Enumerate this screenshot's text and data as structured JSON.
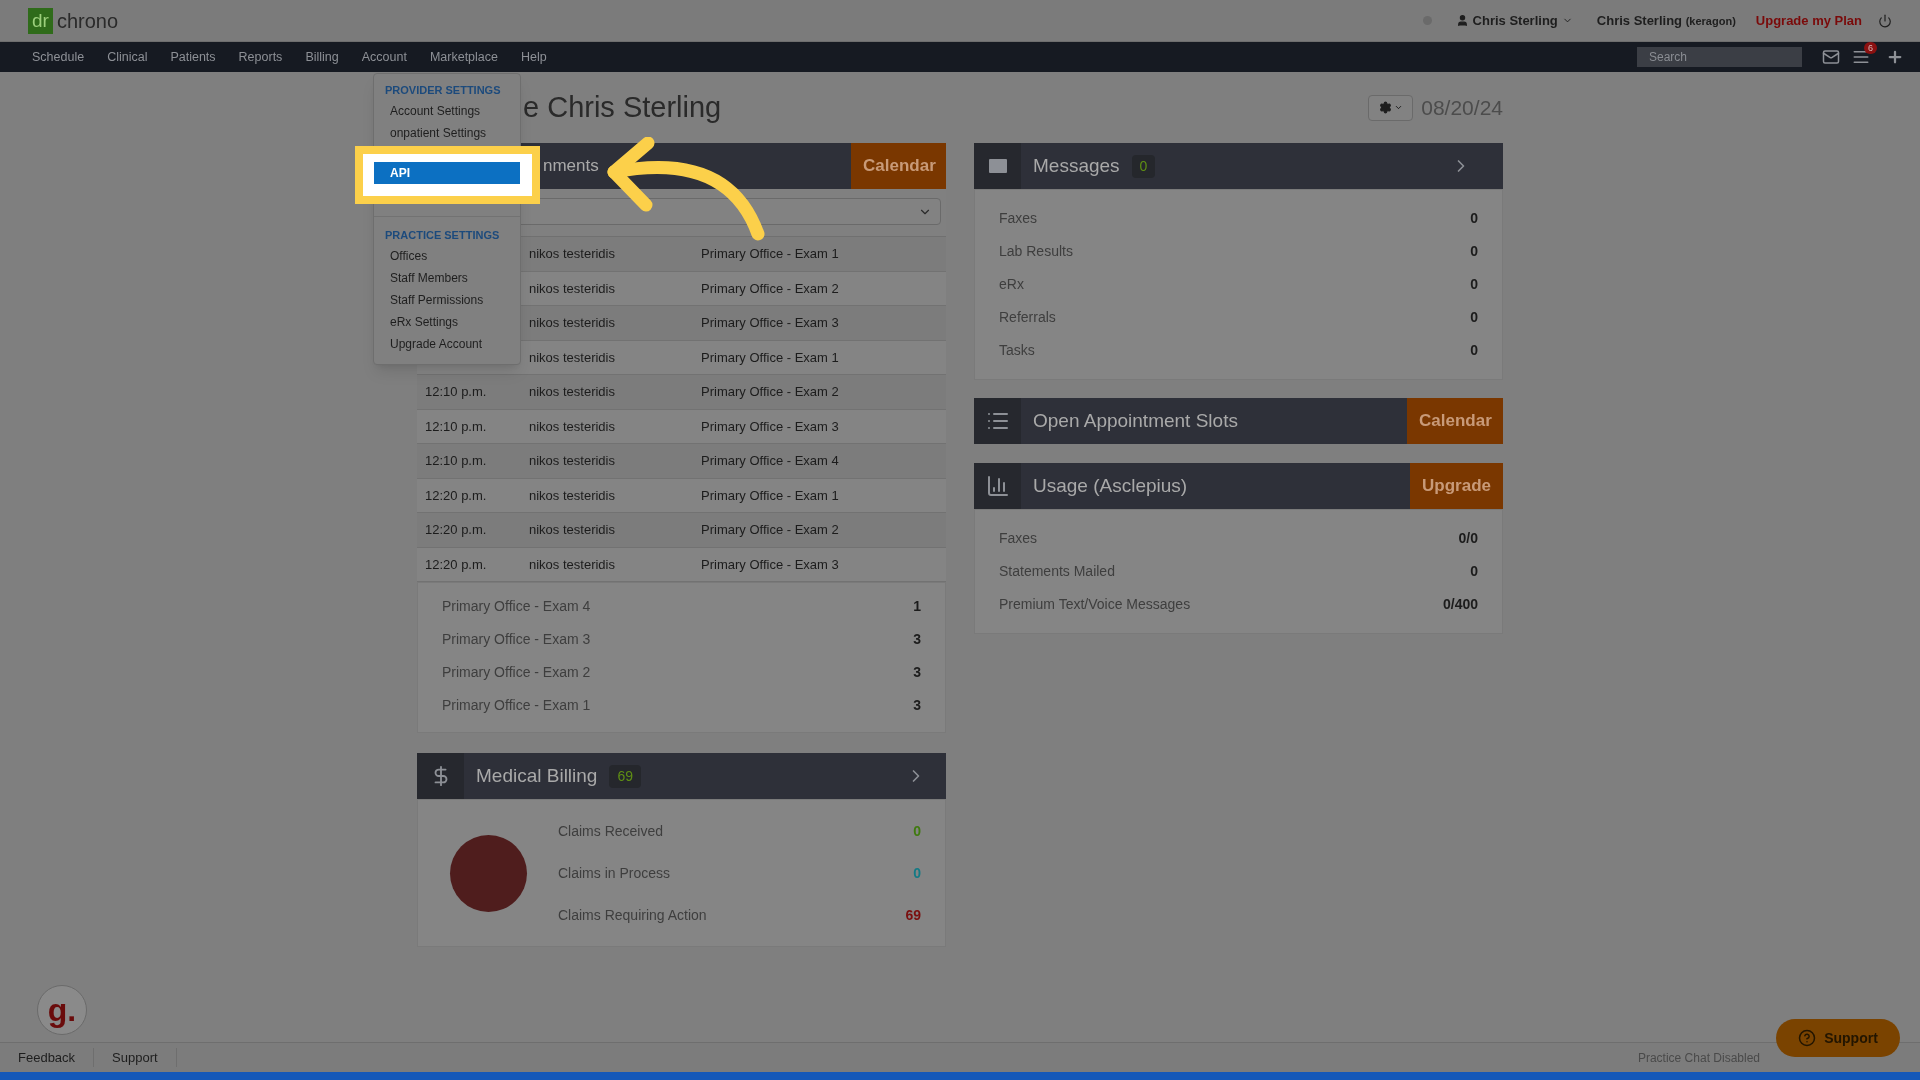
{
  "logo": {
    "prefix": "dr",
    "name": "chrono"
  },
  "user_bar": {
    "user_menu": "Chris Sterling",
    "account": "Chris Sterling",
    "account_suffix": "(keragon)",
    "upgrade_link": "Upgrade my Plan"
  },
  "nav": {
    "items": [
      "Schedule",
      "Clinical",
      "Patients",
      "Reports",
      "Billing",
      "Account",
      "Marketplace",
      "Help"
    ],
    "search": {
      "placeholder": "Search"
    },
    "notifications_badge": "6"
  },
  "account_menu": {
    "sections": [
      {
        "heading": "PROVIDER SETTINGS",
        "items": [
          {
            "label": "Account Settings",
            "selected": false
          },
          {
            "label": "onpatient Settings",
            "selected": false
          },
          {
            "label": "API",
            "selected": true
          }
        ]
      },
      {
        "heading": "PRACTICE SETTINGS",
        "items": [
          {
            "label": "Offices",
            "selected": false
          },
          {
            "label": "Staff Members",
            "selected": false
          },
          {
            "label": "Staff Permissions",
            "selected": false
          },
          {
            "label": "eRx Settings",
            "selected": false
          },
          {
            "label": "Upgrade Account",
            "selected": false
          }
        ]
      }
    ]
  },
  "title": "e Chris Sterling",
  "date": "08/20/24",
  "appointments": {
    "title": "nments",
    "button": "Calendar",
    "rows": [
      {
        "patient": "nikos testeridis",
        "room": "Primary Office - Exam 1"
      },
      {
        "patient": "nikos testeridis",
        "room": "Primary Office - Exam 2"
      },
      {
        "patient": "nikos testeridis",
        "room": "Primary Office - Exam 3"
      },
      {
        "patient": "nikos testeridis",
        "room": "Primary Office - Exam 1"
      },
      {
        "time": "12:10 p.m.",
        "patient": "nikos testeridis",
        "room": "Primary Office - Exam 2"
      },
      {
        "time": "12:10 p.m.",
        "patient": "nikos testeridis",
        "room": "Primary Office - Exam 3"
      },
      {
        "time": "12:10 p.m.",
        "patient": "nikos testeridis",
        "room": "Primary Office - Exam 4"
      },
      {
        "time": "12:20 p.m.",
        "patient": "nikos testeridis",
        "room": "Primary Office - Exam 1"
      },
      {
        "time": "12:20 p.m.",
        "patient": "nikos testeridis",
        "room": "Primary Office - Exam 2"
      },
      {
        "time": "12:20 p.m.",
        "patient": "nikos testeridis",
        "room": "Primary Office - Exam 3"
      }
    ],
    "summary": [
      {
        "label": "Primary Office - Exam 4",
        "count": "1"
      },
      {
        "label": "Primary Office - Exam 3",
        "count": "3"
      },
      {
        "label": "Primary Office - Exam 2",
        "count": "3"
      },
      {
        "label": "Primary Office - Exam 1",
        "count": "3"
      }
    ]
  },
  "billing": {
    "title": "Medical Billing",
    "badge": "69",
    "rows": [
      {
        "label": "Claims Received",
        "value": "0",
        "color": "#3f7a0e"
      },
      {
        "label": "Claims in Process",
        "value": "0",
        "color": "#137a85"
      },
      {
        "label": "Claims Requiring Action",
        "value": "69",
        "color": "#7a0f0f"
      }
    ]
  },
  "messages": {
    "title": "Messages",
    "badge": "0",
    "rows": [
      {
        "label": "Faxes",
        "value": "0"
      },
      {
        "label": "Lab Results",
        "value": "0"
      },
      {
        "label": "eRx",
        "value": "0"
      },
      {
        "label": "Referrals",
        "value": "0"
      },
      {
        "label": "Tasks",
        "value": "0"
      }
    ]
  },
  "open_slots": {
    "title": "Open Appointment Slots",
    "button": "Calendar"
  },
  "usage": {
    "title": "Usage (Asclepius)",
    "button": "Upgrade",
    "rows": [
      {
        "label": "Faxes",
        "value": "0/0"
      },
      {
        "label": "Statements Mailed",
        "value": "0"
      },
      {
        "label": "Premium Text/Voice Messages",
        "value": "0/400"
      }
    ]
  },
  "widget_logo": "g.",
  "footer": {
    "links": [
      "Feedback",
      "Support"
    ],
    "status": "Practice Chat Disabled",
    "support_button": "Support"
  }
}
